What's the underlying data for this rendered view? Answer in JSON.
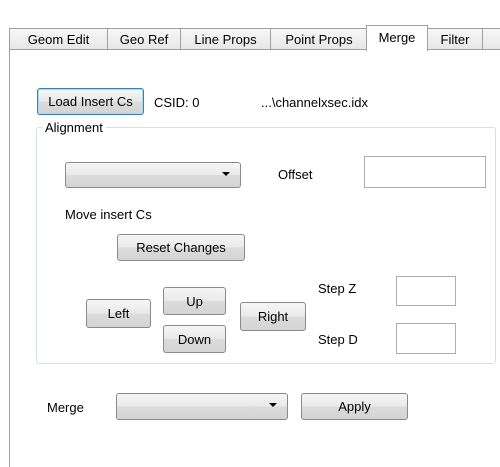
{
  "tabs": [
    {
      "label": "Geom Edit",
      "active": false
    },
    {
      "label": "Geo Ref",
      "active": false
    },
    {
      "label": "Line Props",
      "active": false
    },
    {
      "label": "Point Props",
      "active": false
    },
    {
      "label": "Merge",
      "active": true
    },
    {
      "label": "Filter",
      "active": false
    }
  ],
  "insert": {
    "load_button": "Load Insert Cs",
    "csid_label": "CSID: 0",
    "file_path": "...\\channelxsec.idx"
  },
  "alignment": {
    "title": "Alignment",
    "combo_value": "",
    "offset_label": "Offset",
    "offset_value": "",
    "move_label": "Move insert Cs",
    "reset_button": "Reset Changes",
    "left_button": "Left",
    "up_button": "Up",
    "down_button": "Down",
    "right_button": "Right",
    "step_z_label": "Step Z",
    "step_z_value": "",
    "step_d_label": "Step D",
    "step_d_value": ""
  },
  "merge": {
    "label": "Merge",
    "combo_value": "",
    "apply_button": "Apply"
  }
}
